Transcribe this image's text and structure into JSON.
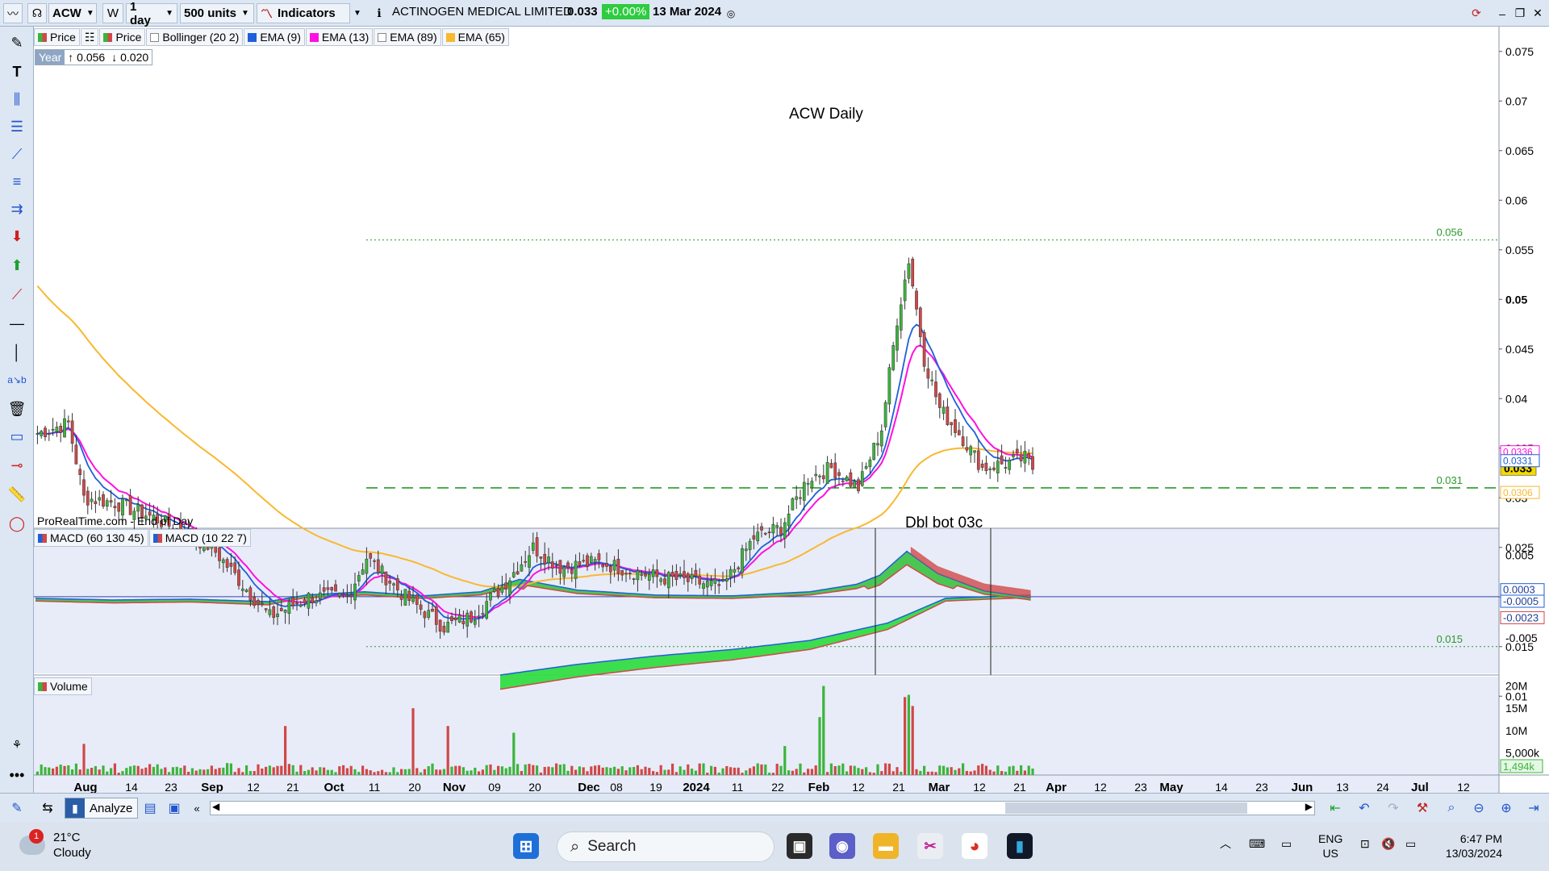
{
  "toolbar": {
    "symbol": "ACW",
    "w_label": "W",
    "interval": "1 day",
    "units": "500 units",
    "indicators_label": "Indicators",
    "info_icon": "info-icon",
    "company": "ACTINOGEN MEDICAL LIMITED",
    "last_price": "0.033",
    "change": "+0.00%",
    "date": "13 Mar 2024"
  },
  "legend": {
    "price1": "Price",
    "price2": "Price",
    "bollinger": "Bollinger (20 2)",
    "ema9": "EMA (9)",
    "ema13": "EMA (13)",
    "ema89": "EMA (89)",
    "ema65": "EMA (65)"
  },
  "year_box": {
    "label": "Year",
    "high": "↑ 0.056",
    "low": "↓ 0.020"
  },
  "source_label": "ProRealTime.com - End of Day",
  "macd_legend": {
    "m1": "MACD (60 130 45)",
    "m2": "MACD (10 22 7)"
  },
  "volume_legend": "Volume",
  "analyze_label": "Analyze",
  "colors": {
    "up": "#3cb43c",
    "down": "#d04848",
    "ema9": "#1f5fd9",
    "ema13": "#ff10e0",
    "ema65": "#f8b830",
    "change_bg": "#2ecc40",
    "grid_line": "#2a9a2a"
  },
  "chart_data": {
    "type": "candlestick",
    "title": "ACW Daily",
    "annotations": [
      {
        "text": "0.056",
        "y": 0.056,
        "style": "dotted"
      },
      {
        "text": "0.031",
        "y": 0.031,
        "style": "dashed"
      },
      {
        "text": "0.015",
        "y": 0.015,
        "style": "dotted"
      },
      {
        "text": "Dbl bot 03c",
        "y": 0.027
      }
    ],
    "price_axis": {
      "ylim": [
        0.0085,
        0.0775
      ],
      "ticks": [
        "0.075",
        "0.07",
        "0.065",
        "0.06",
        "0.055",
        "0.05",
        "0.045",
        "0.04",
        "0.035",
        "0.03",
        "0.025",
        "0.02",
        "0.015",
        "0.01"
      ],
      "tick_values": [
        0.075,
        0.07,
        0.065,
        0.06,
        0.055,
        0.05,
        0.045,
        0.04,
        0.035,
        0.03,
        0.025,
        0.02,
        0.015,
        0.01
      ],
      "bold_tick": "0.05"
    },
    "price_labels": [
      {
        "text": "0.033",
        "y": 0.033,
        "color": "#f5d800",
        "style": "current"
      },
      {
        "text": "0.0336",
        "y": 0.0346,
        "color": "#ff10e0"
      },
      {
        "text": "0.0331",
        "y": 0.0337,
        "color": "#1f5fd9"
      },
      {
        "text": "0.0306",
        "y": 0.0305,
        "color": "#f8b830"
      }
    ],
    "x_axis": {
      "ticks": [
        "Aug",
        "14",
        "23",
        "Sep",
        "12",
        "21",
        "Oct",
        "11",
        "20",
        "Nov",
        "09",
        "20",
        "Dec",
        "08",
        "19",
        "2024",
        "11",
        "22",
        "Feb",
        "12",
        "21",
        "Mar",
        "12",
        "21",
        "Apr",
        "12",
        "23",
        "May",
        "14",
        "23",
        "Jun",
        "13",
        "24",
        "Jul",
        "12"
      ],
      "bold": [
        "Aug",
        "Sep",
        "Oct",
        "Nov",
        "Dec",
        "2024",
        "Feb",
        "Mar",
        "Apr",
        "May",
        "Jun",
        "Jul"
      ]
    },
    "price_key_points": [
      [
        0,
        0.0365
      ],
      [
        8,
        0.0375
      ],
      [
        12,
        0.03
      ],
      [
        20,
        0.0295
      ],
      [
        30,
        0.028
      ],
      [
        45,
        0.025
      ],
      [
        60,
        0.018
      ],
      [
        70,
        0.02
      ],
      [
        80,
        0.02
      ],
      [
        85,
        0.024
      ],
      [
        95,
        0.02
      ],
      [
        105,
        0.017
      ],
      [
        112,
        0.018
      ],
      [
        120,
        0.021
      ],
      [
        128,
        0.025
      ],
      [
        135,
        0.023
      ],
      [
        145,
        0.0235
      ],
      [
        160,
        0.022
      ],
      [
        170,
        0.0215
      ],
      [
        177,
        0.021
      ],
      [
        185,
        0.026
      ],
      [
        192,
        0.027
      ],
      [
        199,
        0.032
      ],
      [
        205,
        0.033
      ],
      [
        212,
        0.031
      ],
      [
        218,
        0.037
      ],
      [
        222,
        0.048
      ],
      [
        225,
        0.054
      ],
      [
        229,
        0.044
      ],
      [
        233,
        0.039
      ],
      [
        239,
        0.036
      ],
      [
        244,
        0.033
      ],
      [
        250,
        0.0335
      ],
      [
        255,
        0.034
      ],
      [
        257,
        0.033
      ]
    ],
    "volume_axis": {
      "ylim": [
        0,
        21000000
      ],
      "ticks": [
        "20M",
        "15M",
        "10M",
        "5,000k"
      ],
      "tick_values": [
        20000000,
        15000000,
        10000000,
        5000000
      ],
      "last_label": "1,494k"
    },
    "volume_spikes": [
      {
        "bar": 12,
        "value": 7000000,
        "dir": "down"
      },
      {
        "bar": 64,
        "value": 11000000,
        "dir": "down"
      },
      {
        "bar": 97,
        "value": 15000000,
        "dir": "down"
      },
      {
        "bar": 106,
        "value": 11000000,
        "dir": "down"
      },
      {
        "bar": 123,
        "value": 9500000,
        "dir": "up"
      },
      {
        "bar": 193,
        "value": 6500000,
        "dir": "up"
      },
      {
        "bar": 202,
        "value": 13000000,
        "dir": "up"
      },
      {
        "bar": 203,
        "value": 20000000,
        "dir": "up"
      },
      {
        "bar": 224,
        "value": 17500000,
        "dir": "down"
      },
      {
        "bar": 225,
        "value": 18000000,
        "dir": "up"
      },
      {
        "bar": 226,
        "value": 15500000,
        "dir": "down"
      }
    ],
    "macd_axis": {
      "ylim": [
        -0.0095,
        0.0083
      ],
      "ticks": [
        "0.005",
        "-0.005"
      ],
      "tick_values": [
        0.005,
        -0.005
      ],
      "labels": [
        {
          "text": "0.0003",
          "y": 0.0008,
          "color": "#1f5fd9"
        },
        {
          "text": "-0.0005",
          "y": -0.0006,
          "color": "#1f5fd9"
        },
        {
          "text": "-0.0023",
          "y": -0.0026,
          "color": "#d04848"
        }
      ]
    },
    "macd_short": [
      [
        0,
        -0.0002
      ],
      [
        20,
        -0.0004
      ],
      [
        40,
        -0.0003
      ],
      [
        60,
        -0.0006
      ],
      [
        70,
        0.0002
      ],
      [
        85,
        0.0006
      ],
      [
        100,
        0.0001
      ],
      [
        115,
        0.0006
      ],
      [
        125,
        0.0021
      ],
      [
        140,
        0.0008
      ],
      [
        160,
        0.0002
      ],
      [
        180,
        0.0001
      ],
      [
        200,
        0.0006
      ],
      [
        212,
        0.0015
      ],
      [
        218,
        0.0026
      ],
      [
        225,
        0.0055
      ],
      [
        233,
        0.0028
      ],
      [
        245,
        0.0007
      ],
      [
        257,
        -0.0001
      ]
    ],
    "macd_long": [
      [
        120,
        -0.0095
      ],
      [
        140,
        -0.0082
      ],
      [
        160,
        -0.0072
      ],
      [
        180,
        -0.0064
      ],
      [
        200,
        -0.0053
      ],
      [
        220,
        -0.0032
      ],
      [
        235,
        -0.0002
      ],
      [
        257,
        0.0002
      ]
    ]
  },
  "taskbar": {
    "temperature": "21°C",
    "weather": "Cloudy",
    "badge": "1",
    "search_placeholder": "Search",
    "lang": "ENG",
    "region": "US",
    "time": "6:47 PM",
    "date": "13/03/2024"
  }
}
